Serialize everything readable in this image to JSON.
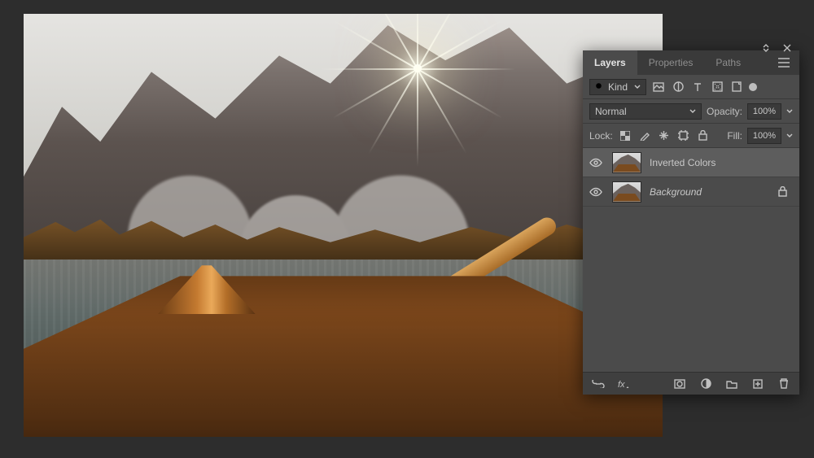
{
  "panel": {
    "tabs": [
      {
        "label": "Layers",
        "active": true
      },
      {
        "label": "Properties",
        "active": false
      },
      {
        "label": "Paths",
        "active": false
      }
    ],
    "filter": {
      "kind_label": "Kind"
    },
    "blend": {
      "mode": "Normal",
      "opacity_label": "Opacity:",
      "opacity_value": "100%"
    },
    "lock": {
      "label": "Lock:",
      "fill_label": "Fill:",
      "fill_value": "100%"
    },
    "layers": [
      {
        "name": "Inverted Colors",
        "selected": true,
        "locked": false,
        "bg": false
      },
      {
        "name": "Background",
        "selected": false,
        "locked": true,
        "bg": true
      }
    ]
  }
}
